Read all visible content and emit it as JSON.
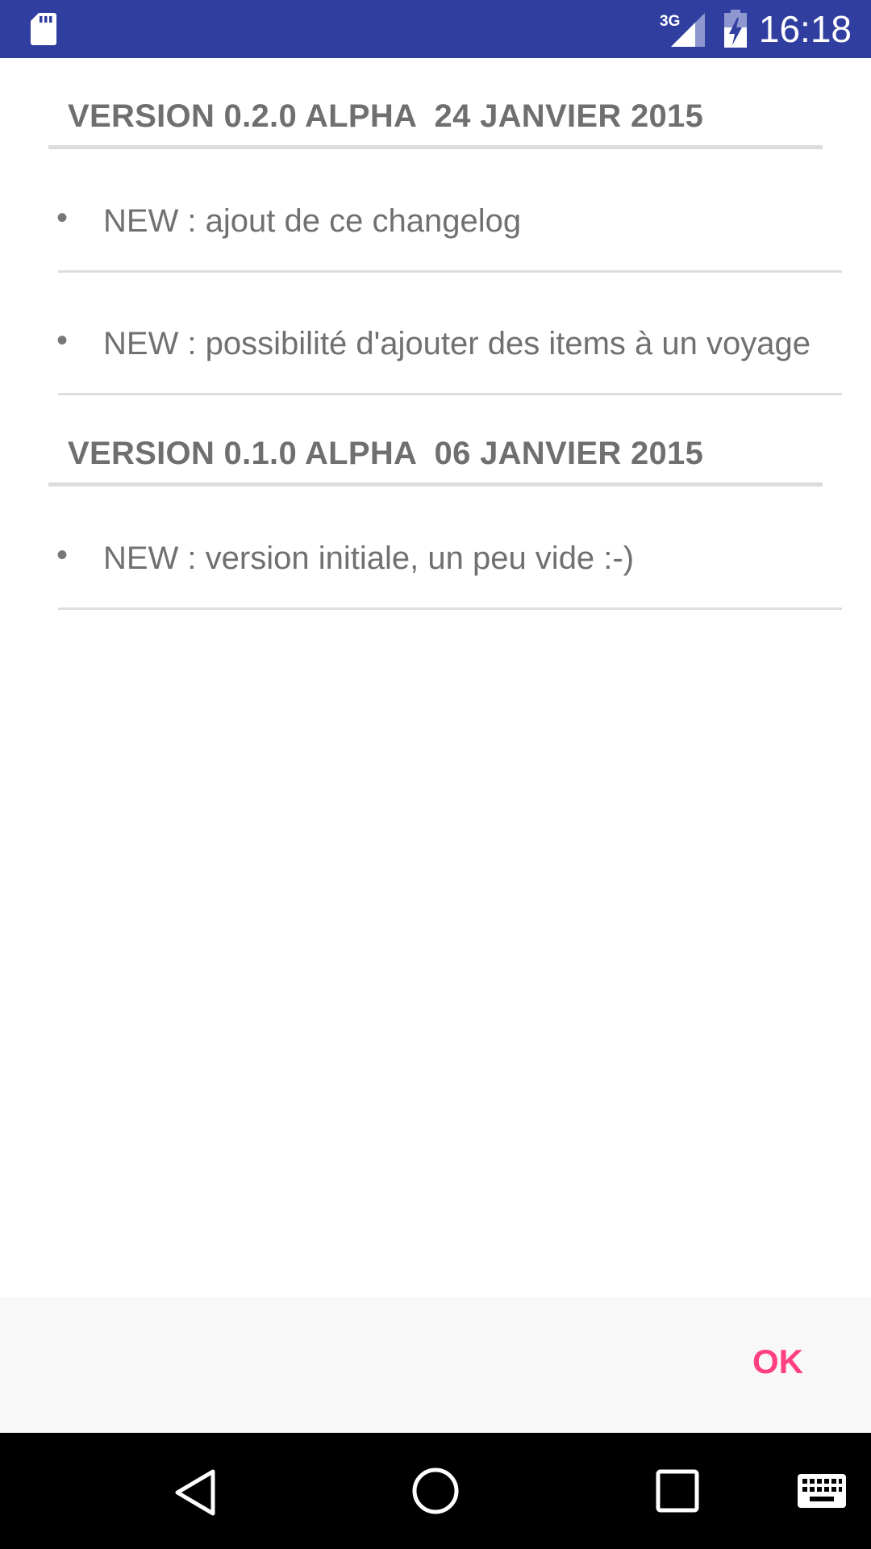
{
  "status_bar": {
    "time": "16:18",
    "network_label": "3G",
    "icons": [
      "sd-card-icon",
      "cellular-signal-icon",
      "battery-charging-icon"
    ]
  },
  "changelog": {
    "versions": [
      {
        "title": "VERSION 0.2.0 ALPHA  24 JANVIER 2015",
        "changes": [
          "NEW : ajout de ce changelog",
          "NEW : possibilité d'ajouter des items à un voyage"
        ]
      },
      {
        "title": "VERSION 0.1.0 ALPHA  06 JANVIER 2015",
        "changes": [
          "NEW : version initiale, un peu vide :-)"
        ]
      }
    ],
    "bullet": "•"
  },
  "dialog": {
    "ok_label": "OK"
  },
  "nav_bar": {
    "icons": [
      "back-icon",
      "home-icon",
      "recents-icon",
      "keyboard-icon"
    ]
  },
  "colors": {
    "status_bar": "#303f9f",
    "accent": "#ff4081",
    "text": "#707070",
    "nav_bar": "#000000"
  }
}
